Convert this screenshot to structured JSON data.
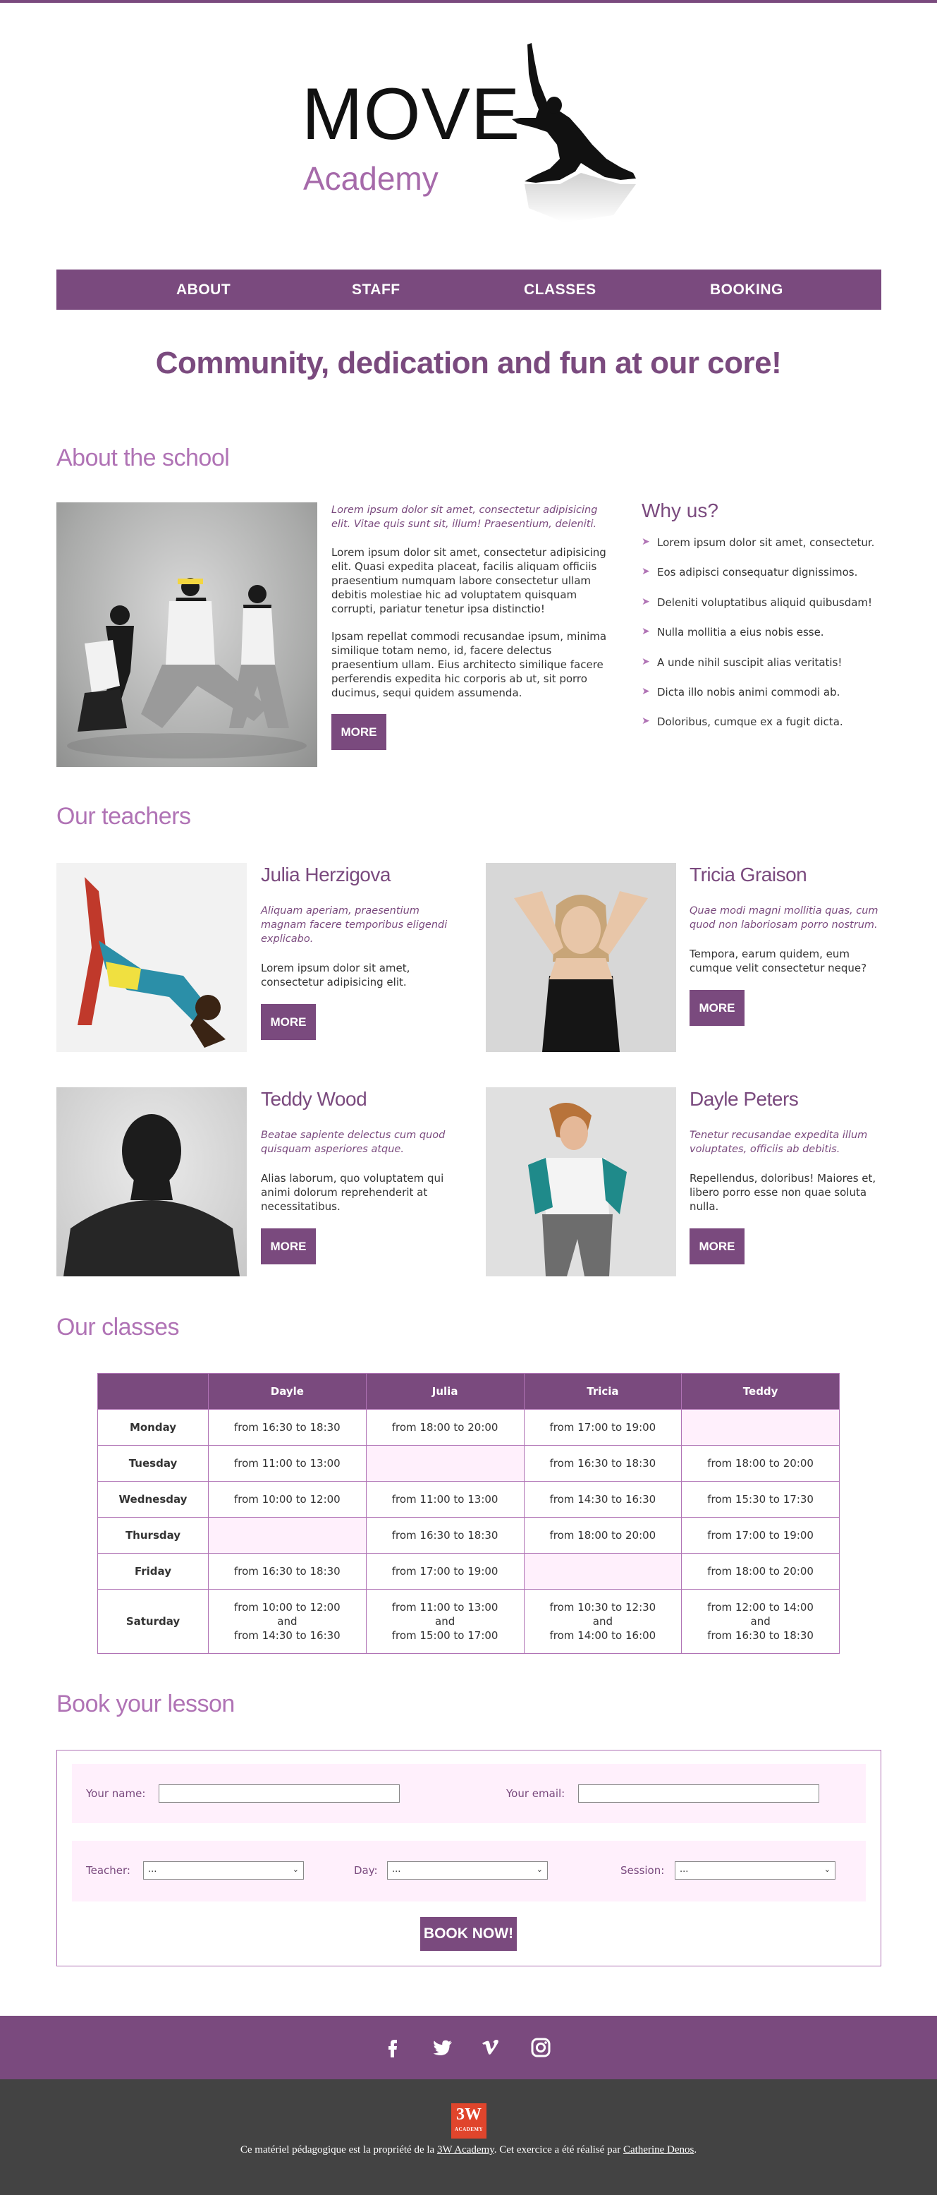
{
  "brand": {
    "name": "MOVE",
    "sub": "Academy",
    "accent": "#7a4a7e",
    "light_accent": "#b073b5",
    "cell_tint": "#fff0fc"
  },
  "nav": [
    {
      "label": "ABOUT"
    },
    {
      "label": "STAFF"
    },
    {
      "label": "CLASSES"
    },
    {
      "label": "BOOKING"
    }
  ],
  "tagline": "Community, dedication and fun at our core!",
  "about": {
    "title": "About the school",
    "intro": "Lorem ipsum dolor sit amet, consectetur adipisicing elit. Vitae quis sunt sit, illum! Praesentium, deleniti.",
    "p1": "Lorem ipsum dolor sit amet, consectetur adipisicing elit. Quasi expedita placeat, facilis aliquam officiis praesentium numquam labore consectetur ullam debitis molestiae hic ad voluptatem quisquam corrupti, pariatur tenetur ipsa distinctio!",
    "p2": "Ipsam repellat commodi recusandae ipsum, minima similique totam nemo, id, facere delectus praesentium ullam. Eius architecto similique facere perferendis expedita hic corporis ab ut, sit porro ducimus, sequi quidem assumenda.",
    "more": "MORE"
  },
  "why": {
    "title": "Why us?",
    "items": [
      "Lorem ipsum dolor sit amet, consectetur.",
      "Eos adipisci consequatur dignissimos.",
      "Deleniti voluptatibus aliquid quibusdam!",
      "Nulla mollitia a eius nobis esse.",
      "A unde nihil suscipit alias veritatis!",
      "Dicta illo nobis animi commodi ab.",
      "Doloribus, cumque ex a fugit dicta."
    ]
  },
  "teachers": {
    "title": "Our teachers",
    "list": [
      {
        "name": "Julia Herzigova",
        "quote": "Aliquam aperiam, praesentium magnam facere temporibus eligendi explicabo.",
        "text": "Lorem ipsum dolor sit amet, consectetur adipisicing elit.",
        "more": "MORE"
      },
      {
        "name": "Tricia Graison",
        "quote": "Quae modi magni mollitia quas, cum quod non laboriosam porro nostrum.",
        "text": "Tempora, earum quidem, eum cumque velit consectetur neque?",
        "more": "MORE"
      },
      {
        "name": "Teddy Wood",
        "quote": "Beatae sapiente delectus cum quod quisquam asperiores atque.",
        "text": "Alias laborum, quo voluptatem qui animi dolorum reprehenderit at necessitatibus.",
        "more": "MORE"
      },
      {
        "name": "Dayle Peters",
        "quote": "Tenetur recusandae expedita illum voluptates, officiis ab debitis.",
        "text": "Repellendus, doloribus! Maiores et, libero porro esse non quae soluta nulla.",
        "more": "MORE"
      }
    ]
  },
  "classes": {
    "title": "Our classes",
    "headers": [
      "",
      "Dayle",
      "Julia",
      "Tricia",
      "Teddy"
    ],
    "rows": [
      {
        "day": "Monday",
        "cells": [
          [
            "from 16:30 to 18:30"
          ],
          [
            "from 18:00 to 20:00"
          ],
          [
            "from 17:00 to 19:00"
          ],
          []
        ]
      },
      {
        "day": "Tuesday",
        "cells": [
          [
            "from 11:00 to 13:00"
          ],
          [],
          [
            "from 16:30 to 18:30"
          ],
          [
            "from 18:00 to 20:00"
          ]
        ]
      },
      {
        "day": "Wednesday",
        "cells": [
          [
            "from 10:00 to 12:00"
          ],
          [
            "from 11:00 to 13:00"
          ],
          [
            "from 14:30 to 16:30"
          ],
          [
            "from 15:30 to 17:30"
          ]
        ]
      },
      {
        "day": "Thursday",
        "cells": [
          [],
          [
            "from 16:30 to 18:30"
          ],
          [
            "from 18:00 to 20:00"
          ],
          [
            "from 17:00 to 19:00"
          ]
        ]
      },
      {
        "day": "Friday",
        "cells": [
          [
            "from 16:30 to 18:30"
          ],
          [
            "from 17:00 to 19:00"
          ],
          [],
          [
            "from 18:00 to 20:00"
          ]
        ]
      },
      {
        "day": "Saturday",
        "cells": [
          [
            "from 10:00 to 12:00",
            "and",
            "from 14:30 to 16:30"
          ],
          [
            "from 11:00 to 13:00",
            "and",
            "from 15:00 to 17:00"
          ],
          [
            "from 10:30 to 12:30",
            "and",
            "from 14:00 to 16:00"
          ],
          [
            "from 12:00 to 14:00",
            "and",
            "from 16:30 to 18:30"
          ]
        ]
      }
    ]
  },
  "booking": {
    "title": "Book your lesson",
    "name_label": "Your name:",
    "email_label": "Your email:",
    "teacher_label": "Teacher:",
    "day_label": "Day:",
    "session_label": "Session:",
    "teacher_value": "...",
    "day_value": "...",
    "session_value": "...",
    "submit": "BOOK NOW!"
  },
  "footer": {
    "social": [
      "facebook-icon",
      "twitter-icon",
      "vimeo-icon",
      "instagram-icon"
    ],
    "badge_top": "3W",
    "badge_bottom": "ACADEMY",
    "credit_pre": "Ce matériel pédagogique est la propriété de la ",
    "credit_link1": "3W Academy",
    "credit_mid": ". Cet exercice a été réalisé par ",
    "credit_link2": "Catherine Denos",
    "credit_post": "."
  }
}
